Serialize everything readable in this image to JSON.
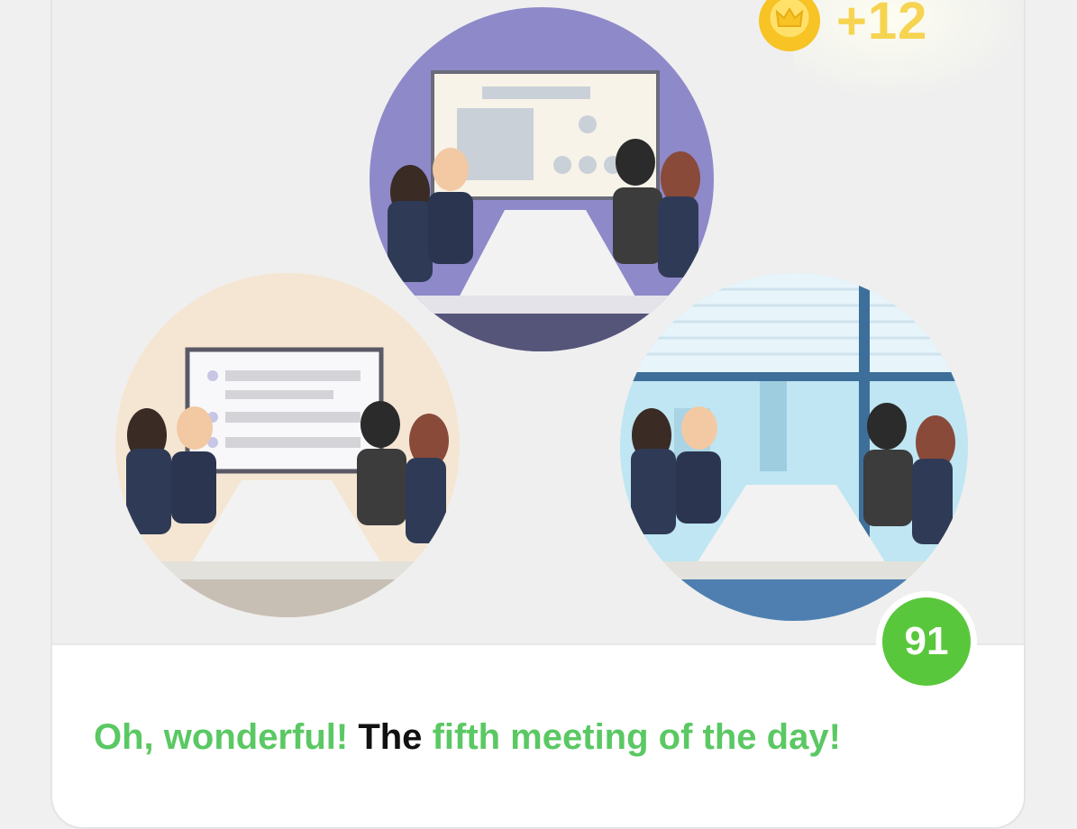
{
  "reward": {
    "icon": "crown-coin-icon",
    "text": "+12"
  },
  "scenes": [
    {
      "name": "meeting-room-purple",
      "background": "#8e89c9"
    },
    {
      "name": "meeting-room-whiteboard",
      "background": "#f5e6d3"
    },
    {
      "name": "meeting-room-office-window",
      "background": "#bfe6f2"
    }
  ],
  "score": {
    "value": "91",
    "color": "#59c73b"
  },
  "sentence": {
    "part1": "Oh, wonderful!",
    "part2": "The",
    "part3": "fifth meeting of the day!"
  },
  "colors": {
    "accent_green": "#5ac863",
    "gold": "#f6d451"
  }
}
